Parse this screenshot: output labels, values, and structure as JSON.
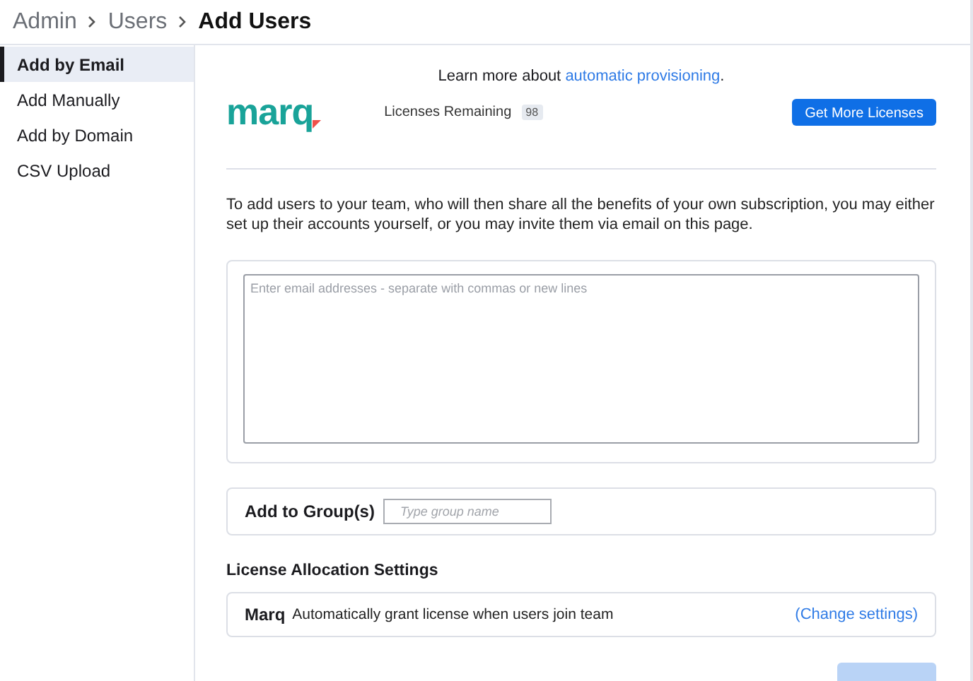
{
  "breadcrumb": [
    {
      "label": "Admin",
      "current": false
    },
    {
      "label": "Users",
      "current": false
    },
    {
      "label": "Add Users",
      "current": true
    }
  ],
  "sidebar": {
    "items": [
      {
        "label": "Add by Email",
        "selected": true
      },
      {
        "label": "Add Manually",
        "selected": false
      },
      {
        "label": "Add by Domain",
        "selected": false
      },
      {
        "label": "CSV Upload",
        "selected": false
      }
    ]
  },
  "info": {
    "prefix": "Learn more about",
    "link": "automatic provisioning",
    "suffix": "."
  },
  "logo": "marq",
  "licenses": {
    "label": "Licenses Remaining",
    "count": "98",
    "button": "Get More Licenses"
  },
  "intro": "To add users to your team, who will then share all the benefits of your own subscription, you may either set up their accounts yourself, or you may invite them via email on this page.",
  "emails": {
    "placeholder": "Enter email addresses - separate with commas or new lines"
  },
  "group": {
    "label": "Add to Group(s)",
    "placeholder": "Type group name"
  },
  "allocation": {
    "heading": "License Allocation Settings",
    "product": "Marq",
    "description": "Automatically grant license when users join team",
    "link": "(Change settings)"
  },
  "submit": {
    "disabled": true
  }
}
